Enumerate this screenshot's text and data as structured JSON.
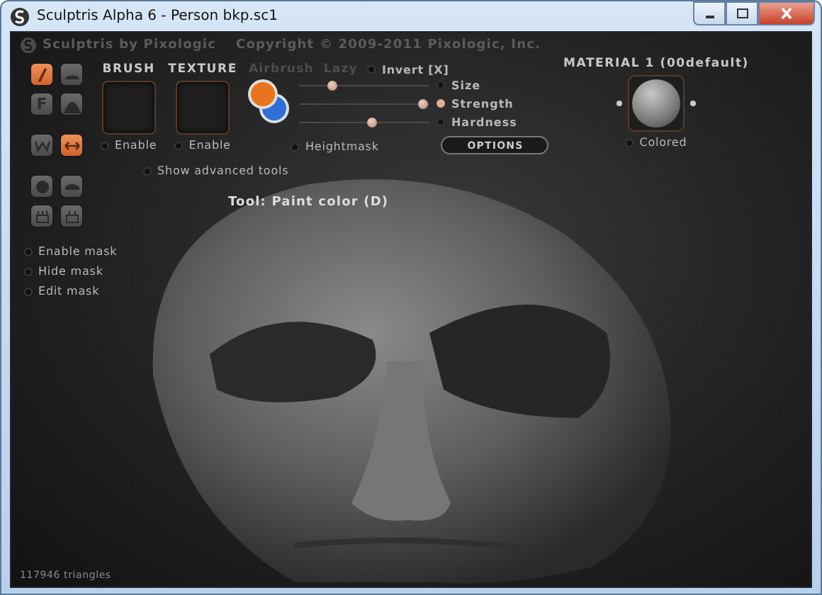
{
  "window": {
    "title": "Sculptris Alpha 6 - Person bkp.sc1"
  },
  "header": {
    "brand": "Sculptris by Pixologic",
    "copyright": "Copyright © 2009-2011 Pixologic, Inc."
  },
  "tools": [
    {
      "kind": "draw",
      "selected": true
    },
    {
      "kind": "crease",
      "selected": false
    },
    {
      "kind": "flatten",
      "label": "F",
      "selected": false
    },
    {
      "kind": "inflate",
      "selected": false
    },
    {
      "kind": "pinch",
      "selected": false
    },
    {
      "kind": "grab",
      "selected": true
    },
    {
      "kind": "smooth",
      "selected": false
    },
    {
      "kind": "reduce",
      "selected": false
    },
    {
      "kind": "rotate",
      "selected": false
    },
    {
      "kind": "scale",
      "selected": false
    }
  ],
  "brush": {
    "label": "BRUSH",
    "enable": {
      "label": "Enable",
      "checked": false
    }
  },
  "texture": {
    "label": "TEXTURE",
    "enable": {
      "label": "Enable",
      "checked": false
    }
  },
  "modes": [
    {
      "label": "Airbrush",
      "disabled": true
    },
    {
      "label": "Lazy",
      "disabled": true
    }
  ],
  "invert": {
    "label": "Invert [X]",
    "checked": false
  },
  "colors": [
    {
      "color": "#e8741e"
    },
    {
      "color": "#2f6fd6"
    }
  ],
  "heightmask": {
    "label": "Heightmask",
    "checked": false
  },
  "advanced": {
    "label": "Show advanced tools",
    "checked": false
  },
  "sliders": [
    {
      "name": "Size",
      "level": 0.25,
      "selected": false
    },
    {
      "name": "Strength",
      "level": 0.95,
      "selected": true
    },
    {
      "name": "Hardness",
      "level": 0.55,
      "selected": false
    }
  ],
  "options_button": "OPTIONS",
  "material": {
    "title": "MATERIAL 1 (00default)",
    "colored": {
      "label": "Colored",
      "checked": false
    }
  },
  "mask": [
    {
      "label": "Enable mask",
      "checked": false
    },
    {
      "label": "Hide mask",
      "checked": false
    },
    {
      "label": "Edit mask",
      "checked": false
    }
  ],
  "viewport": {
    "tool": "Tool: Paint color (D)",
    "status": "117946 triangles"
  }
}
